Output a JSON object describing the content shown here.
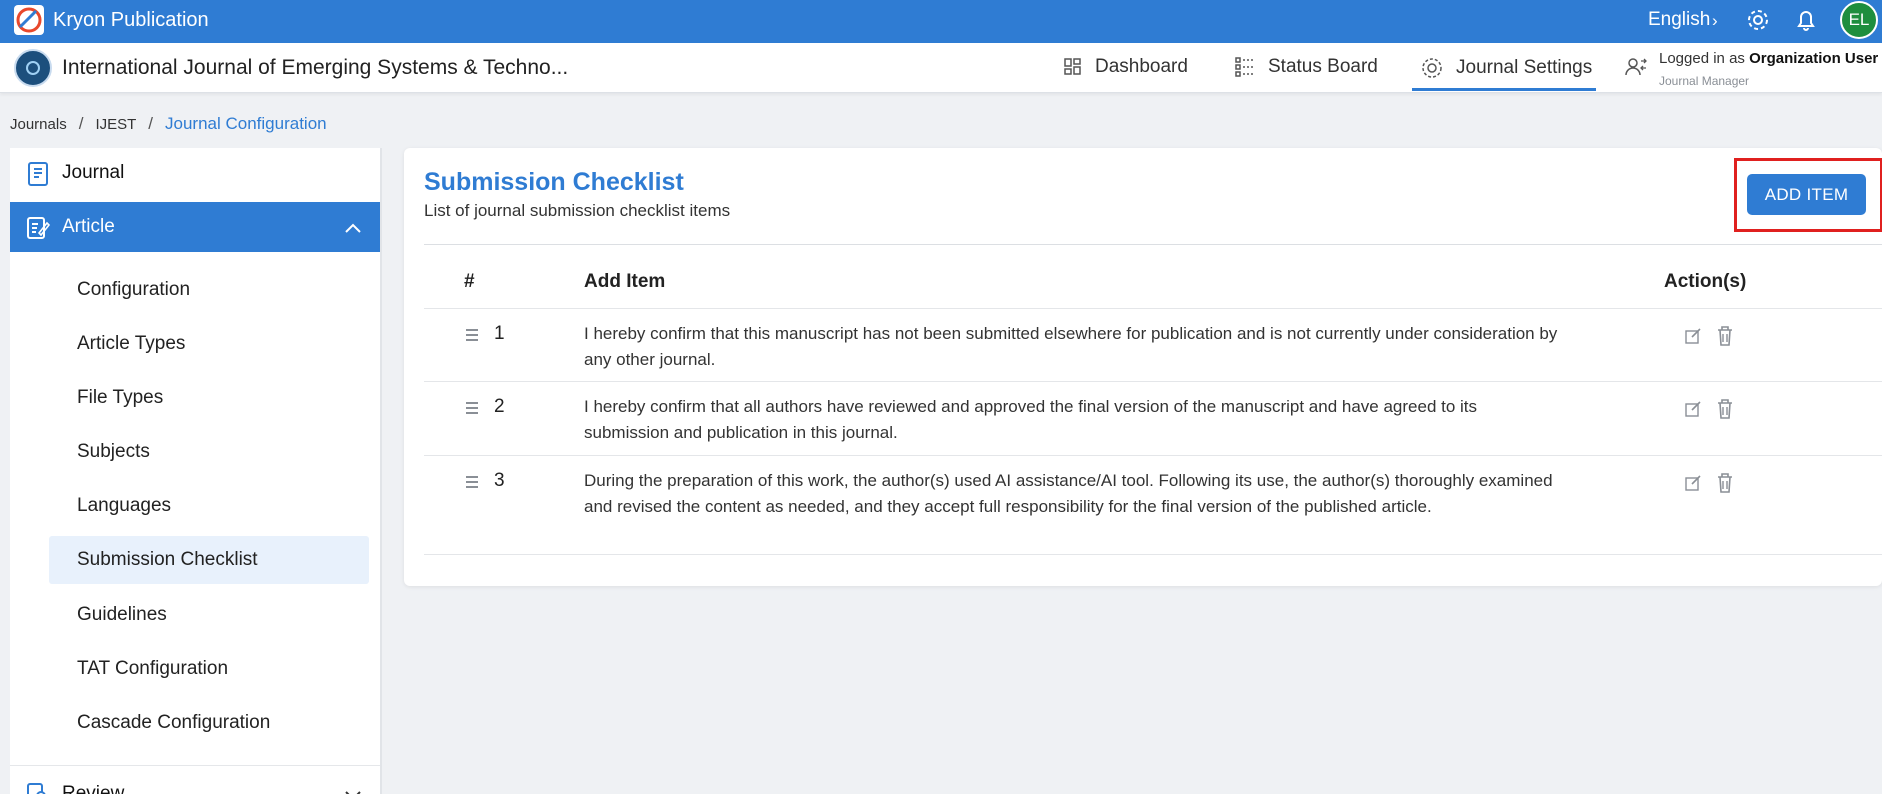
{
  "app": {
    "title": "Kryon Publication",
    "language": "English",
    "avatar_initials": "EL",
    "accent": "#2f7cd3"
  },
  "journal": {
    "name": "International Journal of Emerging Systems & Techno..."
  },
  "nav": {
    "dashboard": "Dashboard",
    "status_board": "Status Board",
    "journal_settings": "Journal Settings"
  },
  "user": {
    "logged_in_prefix": "Logged in as ",
    "name": "Organization User",
    "role": "Journal Manager"
  },
  "breadcrumb": {
    "items": [
      "Journals",
      "IJEST"
    ],
    "current": "Journal Configuration"
  },
  "sidebar": {
    "journal": "Journal",
    "article": "Article",
    "review": "Review",
    "article_items": [
      "Configuration",
      "Article Types",
      "File Types",
      "Subjects",
      "Languages",
      "Submission Checklist",
      "Guidelines",
      "TAT Configuration",
      "Cascade Configuration"
    ]
  },
  "main": {
    "title": "Submission Checklist",
    "subtitle": "List of journal submission checklist items",
    "add_button": "ADD ITEM",
    "columns": {
      "num": "#",
      "item": "Add Item",
      "actions": "Action(s)"
    },
    "rows": [
      {
        "num": "1",
        "text": "I hereby confirm that this manuscript has not been submitted elsewhere for publication and is not currently under consideration by any other journal."
      },
      {
        "num": "2",
        "text": "I hereby confirm that all authors have reviewed and approved the final version of the manuscript and have agreed to its submission and publication in this journal."
      },
      {
        "num": "3",
        "text": "During the preparation of this work, the author(s) used AI assistance/AI tool. Following its use, the author(s) thoroughly examined and revised the content as needed, and they accept full responsibility for the final version of the published article."
      }
    ]
  }
}
